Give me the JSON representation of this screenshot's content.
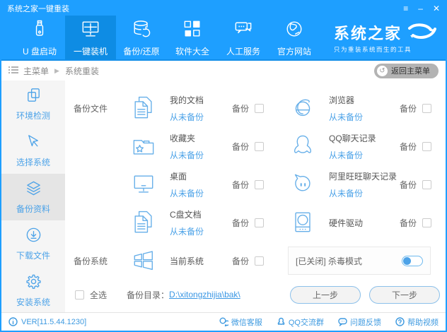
{
  "colors": {
    "primary": "#1E9FFF",
    "accent": "#4DA3E8",
    "nav_active": "#0E8CE4"
  },
  "titlebar": {
    "title": "系统之家一键重装",
    "controls": {
      "menu": "≡",
      "minimize": "–",
      "close": "✕"
    }
  },
  "nav": {
    "items": [
      {
        "label": "U 盘启动",
        "icon": "usb"
      },
      {
        "label": "一键装机",
        "icon": "monitor-windows"
      },
      {
        "label": "备份/还原",
        "icon": "database-restore"
      },
      {
        "label": "软件大全",
        "icon": "apps-grid"
      },
      {
        "label": "人工服务",
        "icon": "chat-service"
      },
      {
        "label": "官方网站",
        "icon": "globe"
      }
    ],
    "active_index": 1,
    "logo_title": "系统之家",
    "logo_tagline": "只为重装系统而生的工具"
  },
  "breadcrumb": {
    "root": "主菜单",
    "separator": "▶",
    "current": "系统重装",
    "back_label": "返回主菜单",
    "back_icon": "↺"
  },
  "sidebar": {
    "items": [
      {
        "label": "环境检测",
        "icon": "pages"
      },
      {
        "label": "选择系统",
        "icon": "cursor"
      },
      {
        "label": "备份资料",
        "icon": "layers"
      },
      {
        "label": "下载文件",
        "icon": "download-circle"
      },
      {
        "label": "安装系统",
        "icon": "gear"
      }
    ],
    "active_index": 2
  },
  "backup": {
    "file_section_label": "备份文件",
    "system_section_label": "备份系统",
    "backup_label": "备份",
    "items": [
      {
        "title": "我的文档",
        "subtitle": "从未备份",
        "icon": "documents"
      },
      {
        "title": "浏览器",
        "subtitle": "从未备份",
        "icon": "browser"
      },
      {
        "title": "收藏夹",
        "subtitle": "从未备份",
        "icon": "folder-star"
      },
      {
        "title": "QQ聊天记录",
        "subtitle": "从未备份",
        "icon": "qq-penguin"
      },
      {
        "title": "桌面",
        "subtitle": "从未备份",
        "icon": "desktop-monitor"
      },
      {
        "title": "阿里旺旺聊天记录",
        "subtitle": "从未备份",
        "icon": "wangwang-bubble"
      },
      {
        "title": "C盘文档",
        "subtitle": "从未备份",
        "icon": "documents"
      },
      {
        "title": "硬件驱动",
        "subtitle": "",
        "icon": "hardware-drive"
      },
      {
        "title": "当前系统",
        "subtitle": "",
        "icon": "windows-logo"
      }
    ],
    "antivirus": {
      "label": "[已关闭] 杀毒模式",
      "state": "off"
    },
    "select_all_label": "全选",
    "backup_dir_label": "备份目录：",
    "backup_dir_value": "D:\\xitongzhijia\\bak\\",
    "prev_button": "上一步",
    "next_button": "下一步"
  },
  "footer": {
    "version": "VER[11.5.44.1230]",
    "links": [
      {
        "label": "微信客服",
        "icon": "wechat"
      },
      {
        "label": "QQ交流群",
        "icon": "qq"
      },
      {
        "label": "问题反馈",
        "icon": "feedback-bubble"
      },
      {
        "label": "帮助视频",
        "icon": "help-circle"
      }
    ]
  }
}
